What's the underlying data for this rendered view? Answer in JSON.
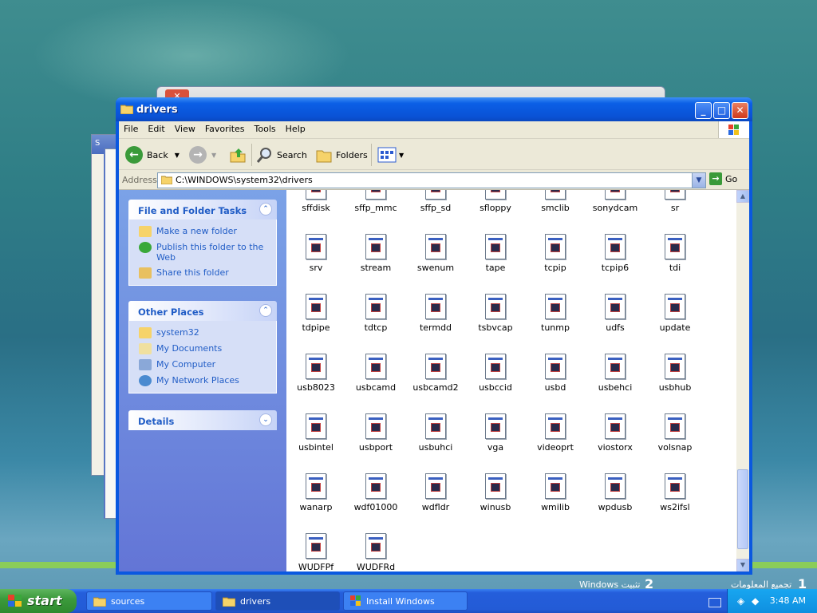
{
  "window": {
    "title": "drivers",
    "min": "_",
    "max": "□",
    "close": "✕"
  },
  "menu": [
    "File",
    "Edit",
    "View",
    "Favorites",
    "Tools",
    "Help"
  ],
  "toolbar": {
    "back": "Back",
    "search": "Search",
    "folders": "Folders"
  },
  "address": {
    "label": "Address",
    "path": "C:\\WINDOWS\\system32\\drivers",
    "go": "Go"
  },
  "tasks": {
    "file_folder": {
      "title": "File and Folder Tasks",
      "items": [
        "Make a new folder",
        "Publish this folder to the Web",
        "Share this folder"
      ]
    },
    "other_places": {
      "title": "Other Places",
      "items": [
        "system32",
        "My Documents",
        "My Computer",
        "My Network Places"
      ]
    },
    "details": {
      "title": "Details"
    }
  },
  "files": [
    "sffdisk",
    "sffp_mmc",
    "sffp_sd",
    "sfloppy",
    "smclib",
    "sonydcam",
    "sr",
    "srv",
    "stream",
    "swenum",
    "tape",
    "tcpip",
    "tcpip6",
    "tdi",
    "tdpipe",
    "tdtcp",
    "termdd",
    "tsbvcap",
    "tunmp",
    "udfs",
    "update",
    "usb8023",
    "usbcamd",
    "usbcamd2",
    "usbccid",
    "usbd",
    "usbehci",
    "usbhub",
    "usbintel",
    "usbport",
    "usbuhci",
    "vga",
    "videoprt",
    "viostorx",
    "volsnap",
    "wanarp",
    "wdf01000",
    "wdfldr",
    "winusb",
    "wmilib",
    "wpdusb",
    "ws2ifsl",
    "WUDFPf",
    "WUDFRd"
  ],
  "desktop_labels": {
    "install": "Windows تثبيت",
    "step2": "2",
    "collect": "تجميع المعلومات",
    "step1": "1"
  },
  "taskbar": {
    "start": "start",
    "tasks": [
      "sources",
      "drivers",
      "Install Windows"
    ],
    "time": "3:48 AM"
  }
}
